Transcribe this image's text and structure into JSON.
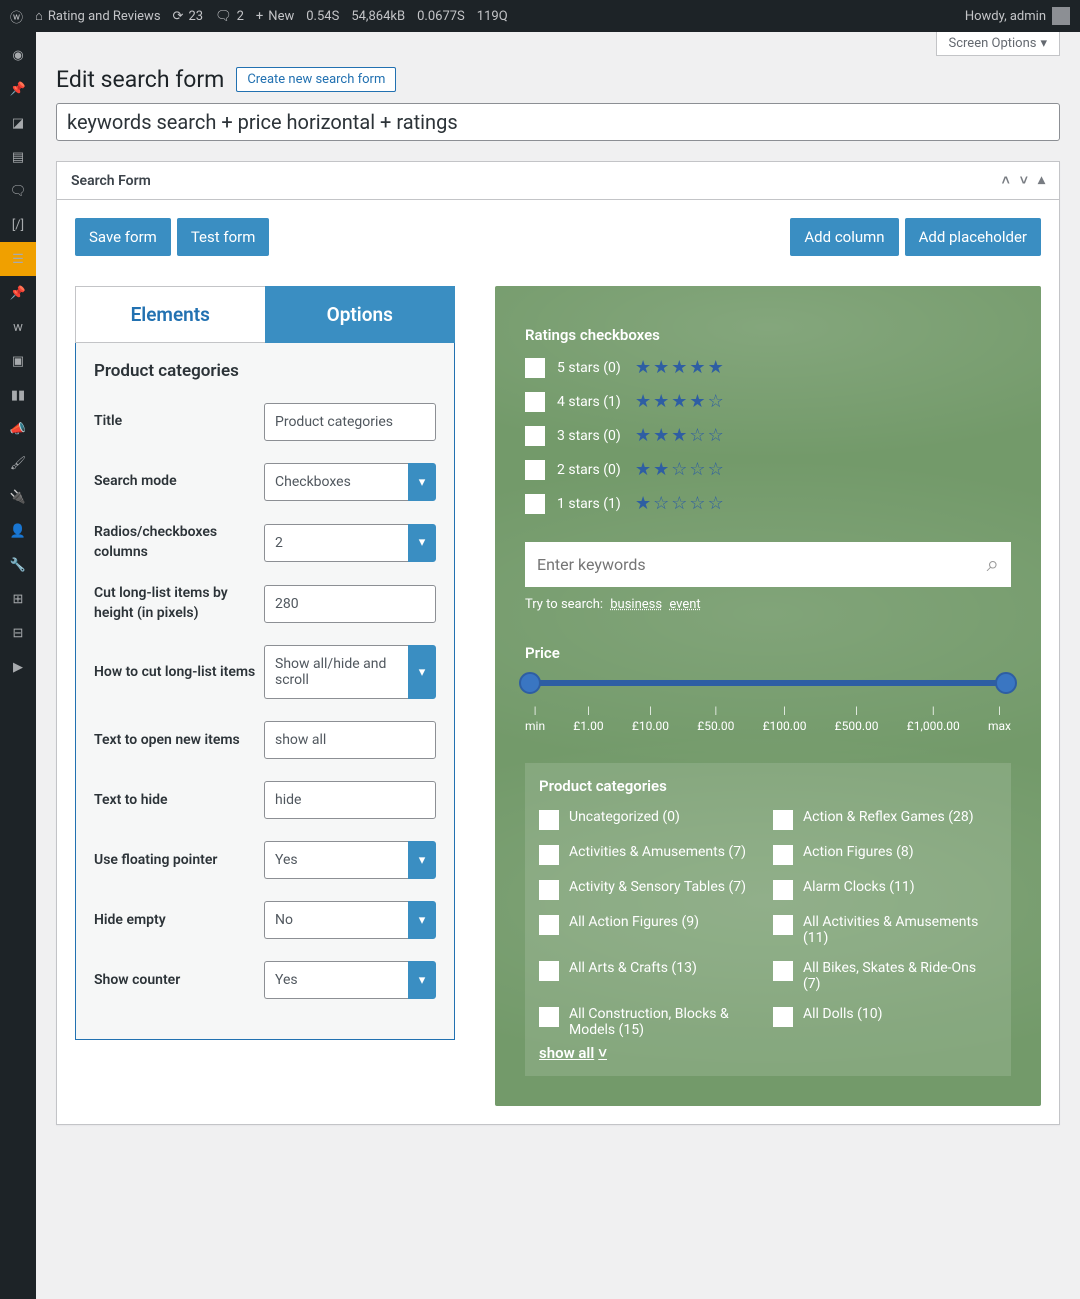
{
  "adminbar": {
    "site_name": "Rating and Reviews",
    "refresh_count": "23",
    "comment_count": "2",
    "new_label": "New",
    "stats": [
      "0.54S",
      "54,864kB",
      "0.0677S",
      "119Q"
    ],
    "howdy": "Howdy, admin"
  },
  "screen_options": "Screen Options",
  "page_title": "Edit search form",
  "create_new": "Create new search form",
  "form_name": "keywords search + price horizontal + ratings",
  "postbox_title": "Search Form",
  "buttons": {
    "save": "Save form",
    "test": "Test form",
    "add_column": "Add column",
    "add_placeholder": "Add placeholder"
  },
  "tabs": {
    "elements": "Elements",
    "options": "Options"
  },
  "panel": {
    "heading": "Product categories",
    "fields": {
      "title": {
        "label": "Title",
        "value": "Product categories"
      },
      "search_mode": {
        "label": "Search mode",
        "value": "Checkboxes"
      },
      "columns": {
        "label": "Radios/checkboxes columns",
        "value": "2"
      },
      "cut_height": {
        "label": "Cut long-list items by height (in pixels)",
        "value": "280"
      },
      "how_cut": {
        "label": "How to cut long-list items",
        "value": "Show all/hide and scroll"
      },
      "text_open": {
        "label": "Text to open new items",
        "value": "show all"
      },
      "text_hide": {
        "label": "Text to hide",
        "value": "hide"
      },
      "floating": {
        "label": "Use floating pointer",
        "value": "Yes"
      },
      "hide_empty": {
        "label": "Hide empty",
        "value": "No"
      },
      "show_counter": {
        "label": "Show counter",
        "value": "Yes"
      }
    }
  },
  "preview": {
    "ratings_title": "Ratings checkboxes",
    "ratings": [
      {
        "label": "5 stars (0)",
        "filled": 5
      },
      {
        "label": "4 stars (1)",
        "filled": 4
      },
      {
        "label": "3 stars (0)",
        "filled": 3
      },
      {
        "label": "2 stars (0)",
        "filled": 2
      },
      {
        "label": "1 stars (1)",
        "filled": 1
      }
    ],
    "keyword_placeholder": "Enter keywords",
    "try_label": "Try to search:",
    "try_link1": "business",
    "try_link2": "event",
    "price_label": "Price",
    "price_ticks": [
      "min",
      "£1.00",
      "£10.00",
      "£50.00",
      "£100.00",
      "£500.00",
      "£1,000.00",
      "max"
    ],
    "categories_title": "Product categories",
    "categories_left": [
      "Uncategorized (0)",
      "Activities & Amusements (7)",
      "Activity & Sensory Tables (7)",
      "All Action Figures (9)",
      "All Arts & Crafts (13)",
      "All Construction, Blocks & Models (15)"
    ],
    "categories_right": [
      "Action & Reflex Games (28)",
      "Action Figures (8)",
      "Alarm Clocks (11)",
      "All Activities & Amusements (11)",
      "All Bikes, Skates & Ride-Ons (7)",
      "All Dolls (10)"
    ],
    "show_all_label": "show all"
  }
}
